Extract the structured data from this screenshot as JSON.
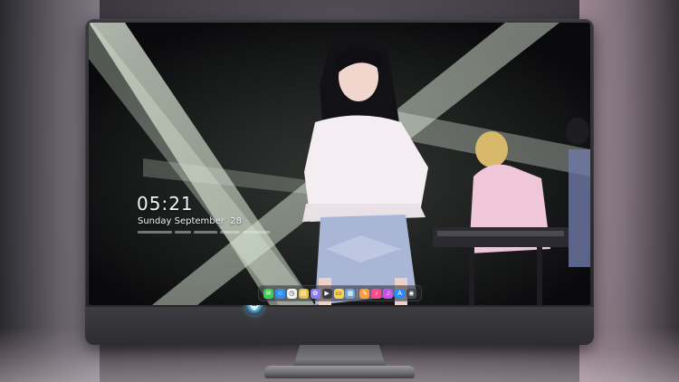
{
  "lock_screen": {
    "time": "05:21",
    "date": "Sunday September  28"
  },
  "dock": {
    "items": [
      {
        "name": "messages-icon",
        "color": "#3ccf4e",
        "glyph": "✉"
      },
      {
        "name": "finder-icon",
        "color": "#2f8ff0",
        "glyph": "☺"
      },
      {
        "name": "clock-icon",
        "color": "#f2f2f2",
        "glyph": "◷"
      },
      {
        "name": "notes-icon",
        "color": "#e7c24a",
        "glyph": "▤"
      },
      {
        "name": "photos-icon",
        "color": "#8a7cf0",
        "glyph": "✿"
      },
      {
        "name": "clapper-icon",
        "color": "#3a3a40",
        "glyph": "▶"
      },
      {
        "name": "stickies-icon",
        "color": "#f5d15a",
        "glyph": "▭"
      },
      {
        "name": "preview-icon",
        "color": "#6fa3d9",
        "glyph": "▦"
      },
      {
        "name": "pen-icon",
        "color": "#ff9b3a",
        "glyph": "✎"
      },
      {
        "name": "music-icon",
        "color": "#fb4a8c",
        "glyph": "♪"
      },
      {
        "name": "music-icon-2",
        "color": "#c94ff0",
        "glyph": "♫"
      },
      {
        "name": "app-store-icon",
        "color": "#2a8cf5",
        "glyph": "A"
      },
      {
        "name": "camera-icon",
        "color": "#4a4a52",
        "glyph": "◉"
      }
    ]
  },
  "colors": {
    "monitor_frame": "#2b2b2f",
    "beam": "#e9f4e4",
    "shirt": "#f3eef2",
    "skirt": "#a9b6d6"
  }
}
